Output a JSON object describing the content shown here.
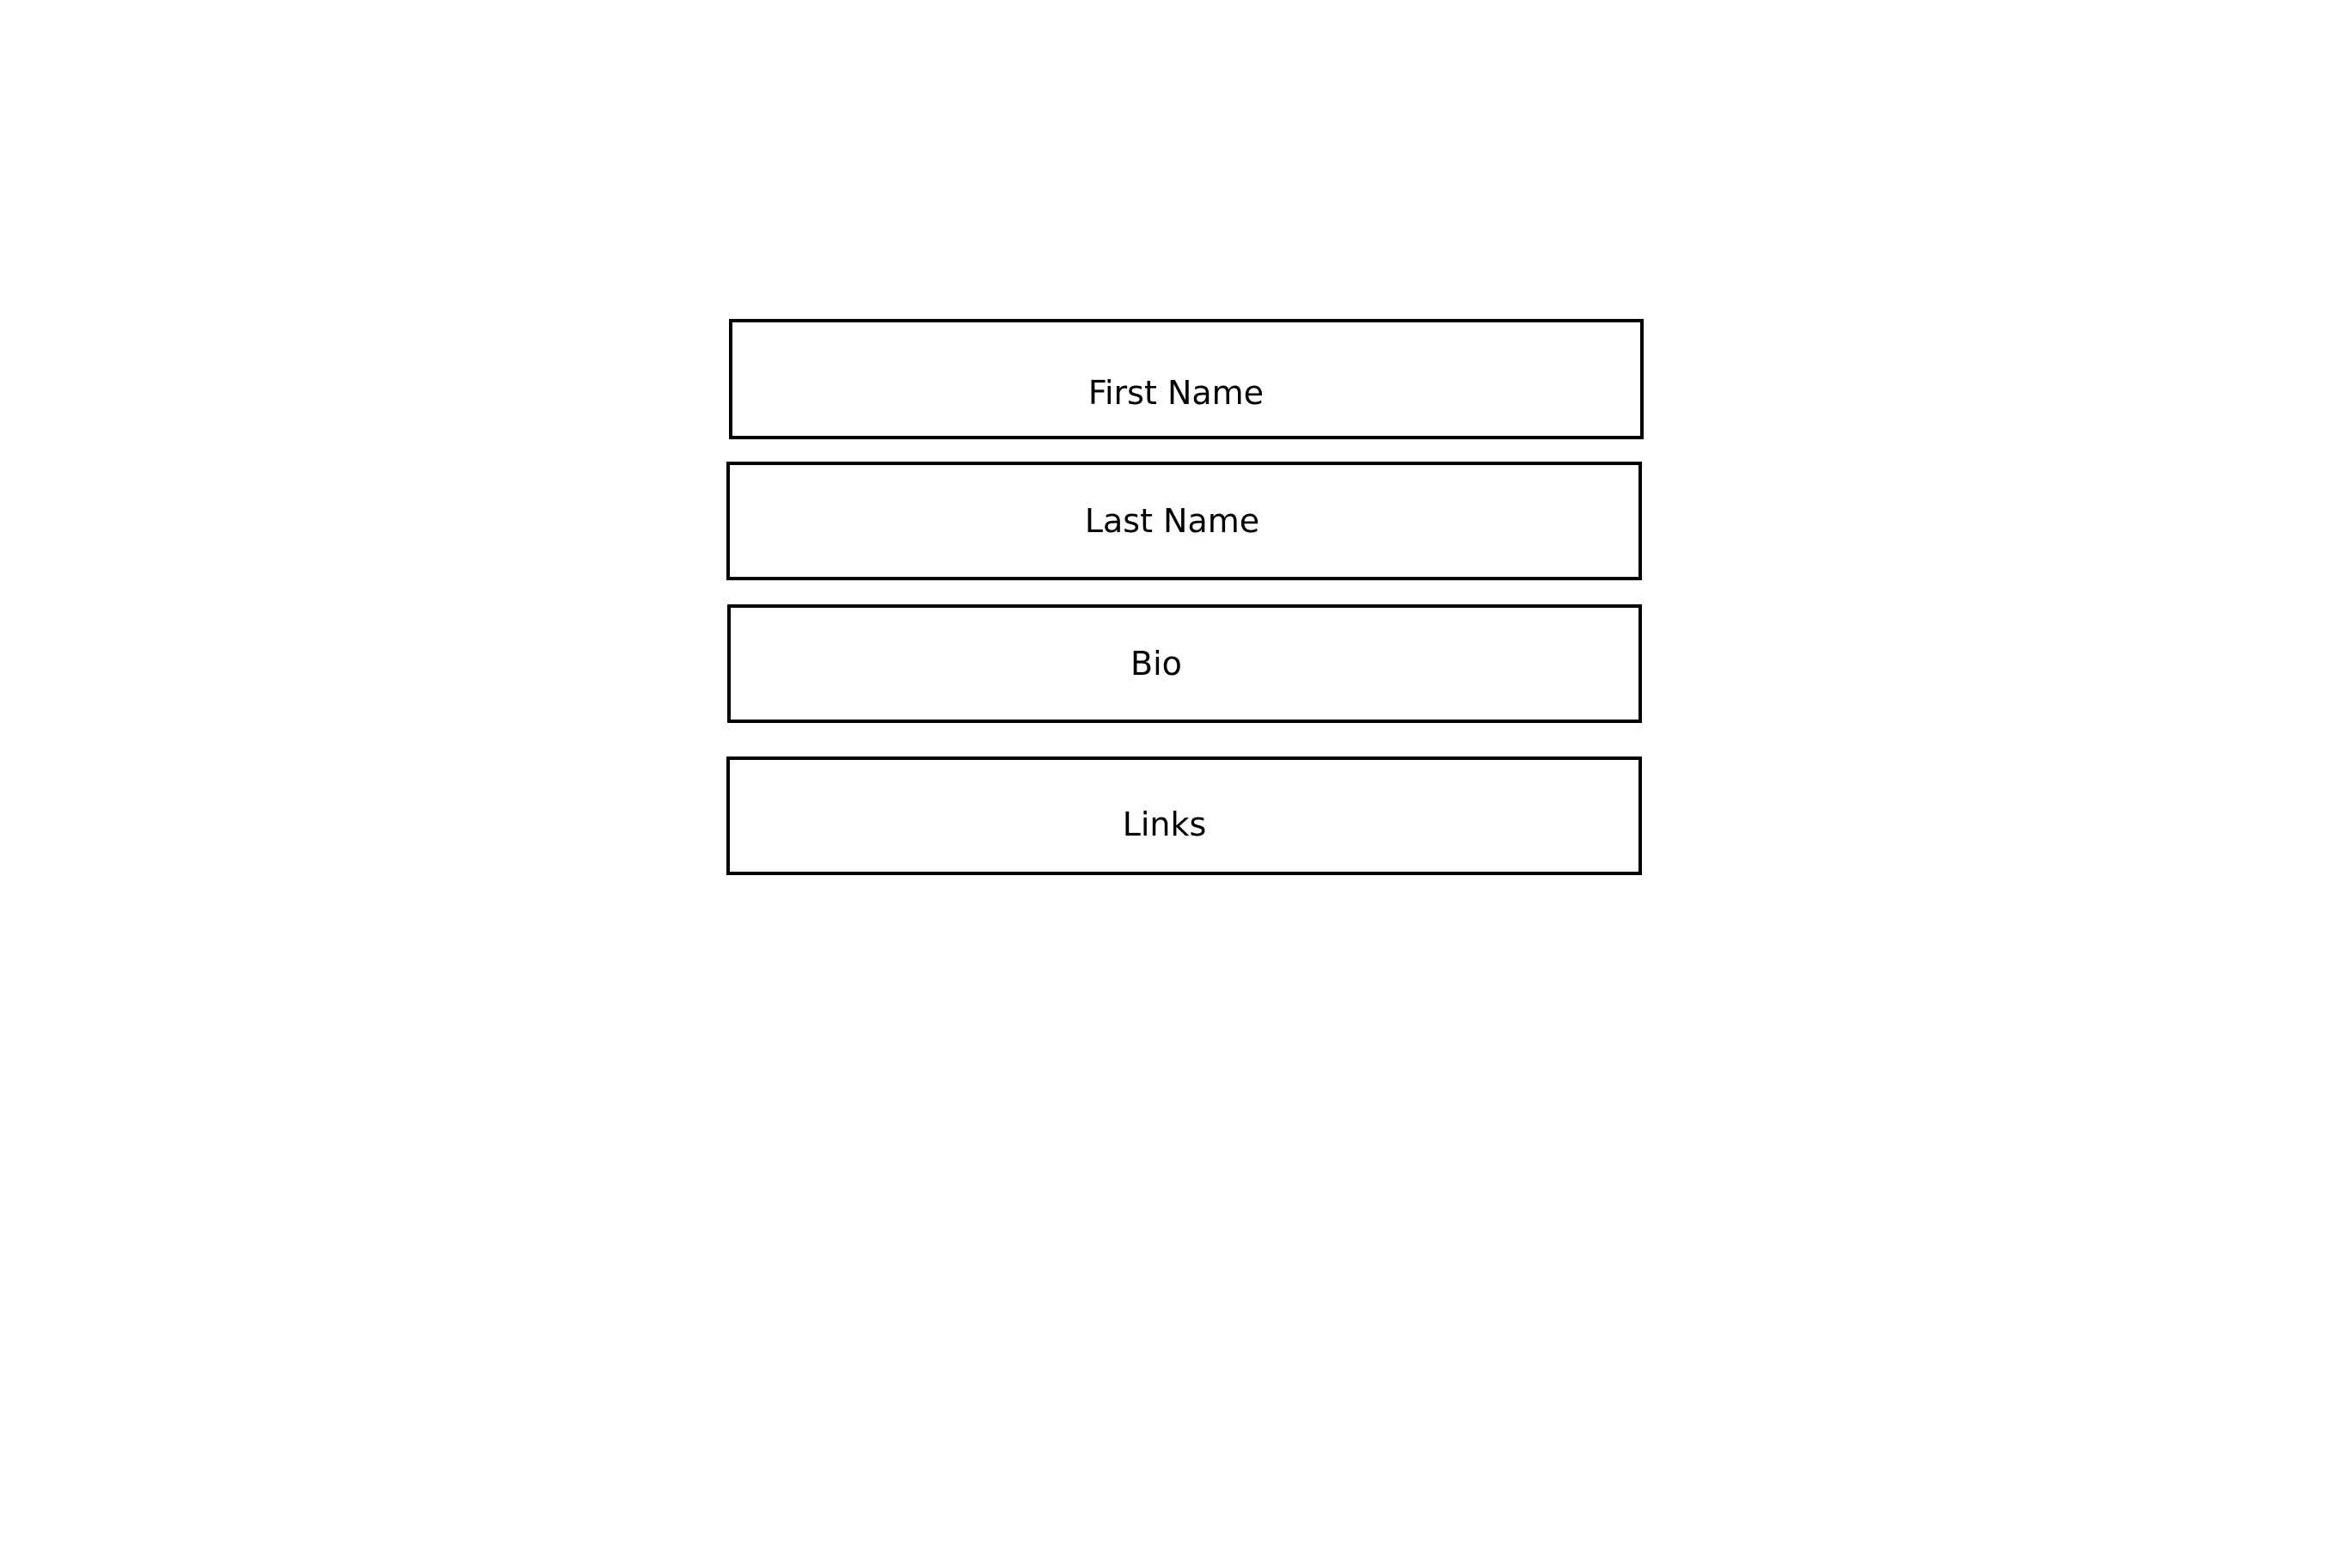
{
  "form": {
    "fields": [
      {
        "label": "First Name"
      },
      {
        "label": "Last Name"
      },
      {
        "label": "Bio"
      },
      {
        "label": "Links"
      }
    ]
  },
  "colors": {
    "background": "#ffffff",
    "border": "#000000",
    "text": "#000000"
  }
}
